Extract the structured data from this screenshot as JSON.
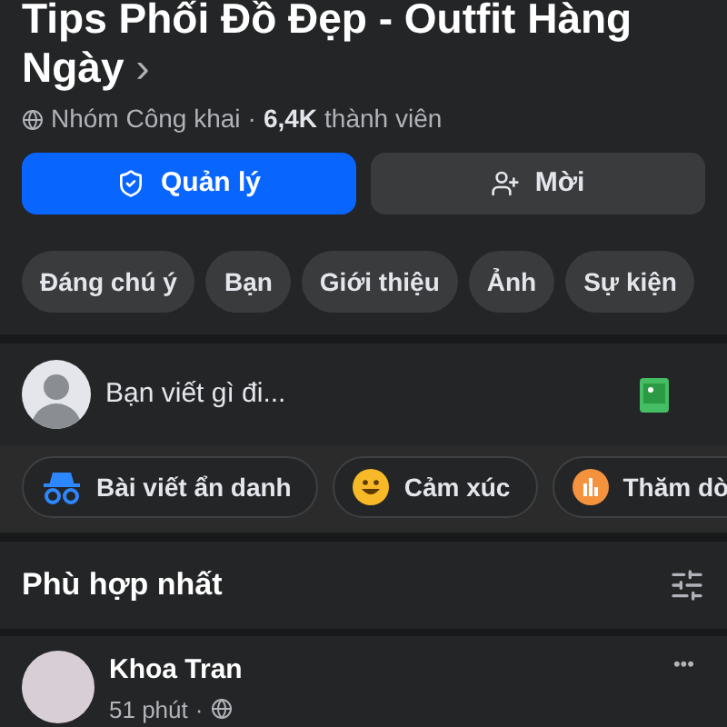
{
  "group": {
    "title": "Tips Phối Đồ Đẹp - Outfit Hàng Ngày",
    "chevron": "›",
    "privacy": "Nhóm Công khai",
    "separator": "·",
    "members_count": "6,4K",
    "members_label": "thành viên"
  },
  "actions": [
    {
      "kind": "primary",
      "label": "Quản lý"
    },
    {
      "kind": "secondary",
      "label": "Mời"
    }
  ],
  "tabs": [
    {
      "label": "Đáng chú ý"
    },
    {
      "label": "Bạn"
    },
    {
      "label": "Giới thiệu"
    },
    {
      "label": "Ảnh"
    },
    {
      "label": "Sự kiện"
    }
  ],
  "composer": {
    "placeholder": "Bạn viết gì đi..."
  },
  "post_options": [
    {
      "kind": "anonymous",
      "label": "Bài viết ẩn danh"
    },
    {
      "kind": "feeling",
      "label": "Cảm xúc"
    },
    {
      "kind": "poll",
      "label": "Thăm dò"
    }
  ],
  "sort": {
    "label": "Phù hợp nhất"
  },
  "post": {
    "author": "Khoa Tran",
    "time": "51 phút",
    "separator": "·",
    "more": "•••"
  }
}
